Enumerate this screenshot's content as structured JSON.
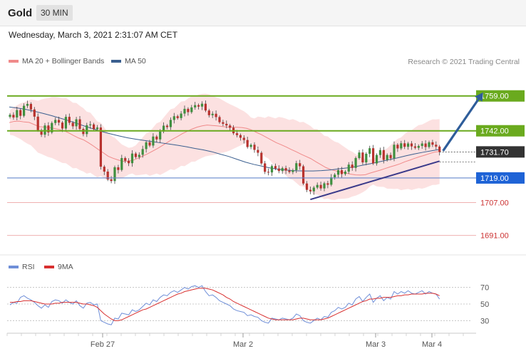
{
  "header": {
    "asset": "Gold",
    "timeframe": "30 MIN"
  },
  "datetime": "Wednesday, March 3, 2021 2:31:07 AM CET",
  "legend": {
    "ma20": "MA 20 + Bollinger Bands",
    "ma50": "MA 50",
    "ma20_color": "#f08a8a",
    "ma50_color": "#3a5f8f"
  },
  "credit": "Research © 2021 Trading Central",
  "rsi_legend": {
    "rsi": "RSI",
    "ma": "9MA",
    "rsi_color": "#6f8fd8",
    "ma_color": "#d83030"
  },
  "chart_data": {
    "type": "line",
    "title": "Gold 30 MIN",
    "x_ticks": [
      "Feb 27",
      "Mar 2",
      "Mar 3",
      "Mar 4"
    ],
    "ylim": [
      1686,
      1778
    ],
    "current_price": "1731.70",
    "levels": [
      {
        "value": 1759.0,
        "label": "1759.00",
        "style": "green-box",
        "color": "#6aaa1e"
      },
      {
        "value": 1742.0,
        "label": "1742.00",
        "style": "green-box",
        "color": "#6aaa1e"
      },
      {
        "value": 1719.0,
        "label": "1719.00",
        "style": "blue-box",
        "color": "#1e63d6"
      },
      {
        "value": 1707.0,
        "label": "1707.00",
        "style": "red-text",
        "color": "#cc3333"
      },
      {
        "value": 1691.0,
        "label": "1691.00",
        "style": "red-text",
        "color": "#cc3333"
      }
    ],
    "close": [
      1749.8,
      1748.5,
      1752.1,
      1749.3,
      1754.2,
      1755.1,
      1752.4,
      1748.9,
      1742.3,
      1740.1,
      1744.6,
      1741.2,
      1745.8,
      1747.3,
      1746.0,
      1743.1,
      1748.8,
      1745.9,
      1744.2,
      1747.6,
      1742.9,
      1740.4,
      1744.7,
      1745.1,
      1742.8,
      1743.6,
      1724.5,
      1722.1,
      1718.3,
      1717.5,
      1724.2,
      1722.9,
      1728.7,
      1727.4,
      1726.2,
      1730.9,
      1729.2,
      1730.3,
      1733.1,
      1736.4,
      1734.8,
      1739.2,
      1737.8,
      1741.6,
      1744.5,
      1743.8,
      1747.3,
      1749.1,
      1748.2,
      1750.4,
      1752.7,
      1751.1,
      1753.4,
      1754.5,
      1753.8,
      1755.2,
      1751.9,
      1749.6,
      1750.3,
      1748.7,
      1746.2,
      1745.4,
      1744.6,
      1743.5,
      1740.8,
      1739.9,
      1738.6,
      1737.5,
      1734.1,
      1735.2,
      1732.7,
      1731.3,
      1726.1,
      1722.0,
      1721.7,
      1724.8,
      1723.6,
      1722.4,
      1723.8,
      1722.6,
      1721.9,
      1722.8,
      1726.2,
      1724.7,
      1716.3,
      1713.2,
      1712.5,
      1714.3,
      1715.6,
      1713.9,
      1716.4,
      1715.7,
      1719.3,
      1720.6,
      1722.8,
      1720.9,
      1722.1,
      1725.5,
      1723.9,
      1728.7,
      1731.4,
      1726.6,
      1730.8,
      1733.5,
      1726.1,
      1730.2,
      1732.6,
      1727.8,
      1730.2,
      1728.6,
      1735.2,
      1733.4,
      1735.9,
      1734.2,
      1735.8,
      1734.4,
      1733.7,
      1734.6,
      1735.8,
      1734.1,
      1736.4,
      1735.2,
      1734.3,
      1731.7
    ],
    "ma20": [
      1746.0,
      1746.6,
      1746.7,
      1746.3,
      1746.1,
      1745.1,
      1744.0,
      1743.8,
      1743.6,
      1743.2,
      1742.7,
      1742.1,
      1741.0,
      1739.7,
      1738.5,
      1737.6,
      1736.2,
      1734.6,
      1732.9,
      1731.3,
      1729.6,
      1728.6,
      1727.8,
      1727.1,
      1727.2,
      1727.6,
      1728.6,
      1729.7,
      1730.8,
      1732.1,
      1733.4,
      1734.9,
      1736.4,
      1737.9,
      1739.2,
      1740.6,
      1741.8,
      1742.9,
      1743.8,
      1744.4,
      1744.8,
      1744.6,
      1744.4,
      1744.1,
      1743.8,
      1743.7,
      1743.7,
      1743.6,
      1743.2,
      1742.4,
      1741.2,
      1740.1,
      1738.8,
      1737.5,
      1736.2,
      1735.2,
      1734.1,
      1732.9,
      1731.8,
      1730.6,
      1729.5,
      1728.4,
      1726.9,
      1725.5,
      1724.1,
      1723.1,
      1722.5,
      1721.9,
      1721.4,
      1720.9,
      1720.5,
      1720.4,
      1720.6,
      1721.4,
      1722.1,
      1722.8,
      1723.6,
      1724.4,
      1725.1,
      1725.9,
      1726.9,
      1727.7,
      1728.6,
      1729.4,
      1730.1,
      1730.9,
      1731.6,
      1731.9
    ],
    "ma50": [
      1753.6,
      1753.1,
      1752.4,
      1751.5,
      1750.5,
      1749.4,
      1748.2,
      1747.0,
      1745.6,
      1744.2,
      1742.9,
      1741.6,
      1740.5,
      1739.5,
      1738.6,
      1737.9,
      1737.3,
      1736.7,
      1736.1,
      1735.5,
      1734.9,
      1734.2,
      1733.4,
      1732.7,
      1731.8,
      1730.6,
      1729.5,
      1728.1,
      1726.7,
      1725.6,
      1724.7,
      1723.8,
      1723.2,
      1722.8,
      1722.5,
      1722.4,
      1722.4,
      1722.6,
      1722.9,
      1723.4,
      1723.9,
      1724.5,
      1725.3,
      1726.1,
      1727.0,
      1727.9,
      1728.8,
      1729.8,
      1730.7,
      1731.5,
      1732.2,
      1732.9
    ],
    "rsi": [
      49,
      52,
      51,
      58,
      60,
      57,
      55,
      52,
      48,
      45,
      49,
      46,
      53,
      55,
      54,
      51,
      55,
      52,
      50,
      54,
      48,
      45,
      51,
      52,
      49,
      50,
      30,
      28,
      26,
      25,
      33,
      32,
      39,
      38,
      37,
      43,
      41,
      43,
      47,
      51,
      49,
      55,
      53,
      58,
      61,
      60,
      64,
      66,
      64,
      67,
      70,
      68,
      71,
      72,
      70,
      72,
      65,
      60,
      61,
      58,
      54,
      52,
      50,
      48,
      44,
      42,
      41,
      40,
      36,
      37,
      35,
      34,
      30,
      28,
      27,
      33,
      32,
      31,
      33,
      32,
      31,
      33,
      38,
      36,
      30,
      28,
      27,
      30,
      33,
      31,
      35,
      34,
      40,
      42,
      46,
      44,
      46,
      51,
      49,
      56,
      59,
      53,
      58,
      62,
      52,
      57,
      60,
      54,
      58,
      56,
      65,
      62,
      65,
      63,
      66,
      63,
      62,
      64,
      66,
      62,
      65,
      63,
      62,
      56
    ],
    "rsi_ma": [
      52,
      52,
      53,
      53,
      54,
      54,
      54,
      53,
      52,
      51,
      50,
      50,
      50,
      51,
      51,
      52,
      52,
      52,
      52,
      52,
      51,
      50,
      50,
      49,
      48,
      46,
      42,
      38,
      35,
      32,
      30,
      30,
      31,
      33,
      35,
      37,
      39,
      41,
      43,
      44,
      46,
      48,
      50,
      52,
      54,
      56,
      58,
      60,
      62,
      63,
      65,
      66,
      67,
      68,
      69,
      69,
      69,
      68,
      67,
      65,
      63,
      61,
      58,
      56,
      53,
      51,
      49,
      47,
      45,
      43,
      41,
      39,
      37,
      35,
      33,
      32,
      31,
      31,
      31,
      31,
      31,
      31,
      32,
      33,
      33,
      32,
      31,
      31,
      31,
      31,
      32,
      33,
      35,
      37,
      39,
      41,
      43,
      45,
      47,
      49,
      51,
      53,
      54,
      56,
      56,
      57,
      57,
      58,
      58,
      58,
      59,
      60,
      60,
      61,
      61,
      62,
      62,
      62,
      62,
      63,
      63,
      63,
      62,
      60
    ],
    "rsi_ticks": [
      70,
      50,
      30
    ],
    "trendline": {
      "from": {
        "index": 86,
        "value": 1708.5
      },
      "to": {
        "index": 123,
        "value": 1727.2
      }
    },
    "projection": {
      "from": {
        "index": 124,
        "value": 1732.2
      },
      "to": {
        "index": 136,
        "value": 1759.0
      }
    }
  }
}
